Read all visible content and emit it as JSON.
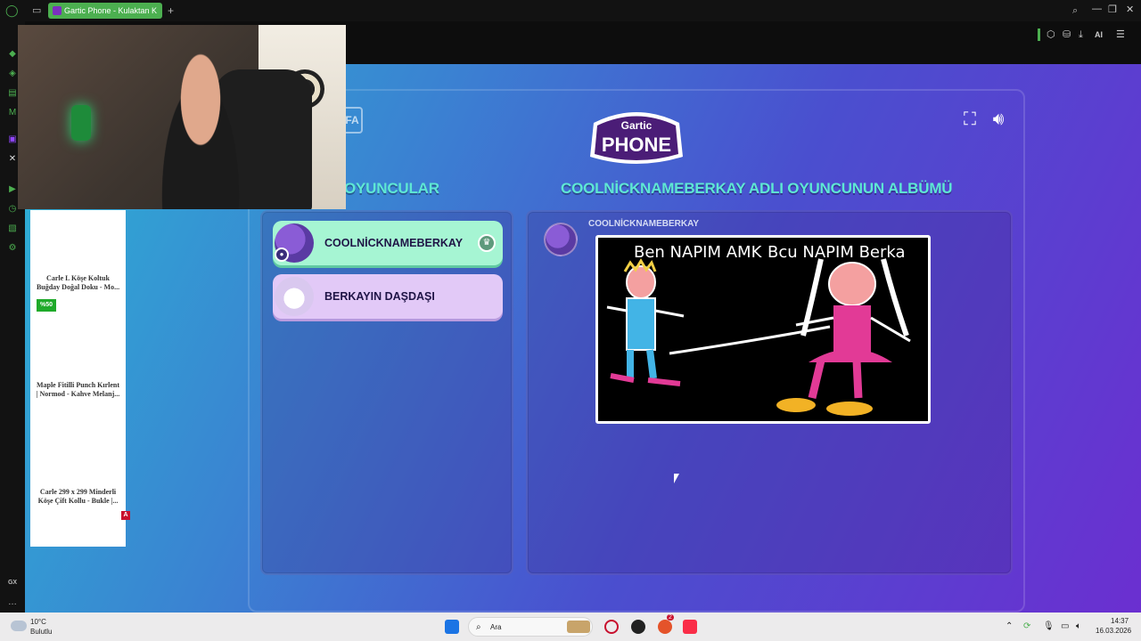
{
  "browser": {
    "tab_title": "Gartic Phone - Kulaktan K",
    "new_tab": "+",
    "ai_label": "AI",
    "sidebar_gx": "GX"
  },
  "ads": {
    "items": [
      {
        "title_line1": "Carle L Köşe Koltuk",
        "title_line2": "Buğday Doğal Doku - Mo..."
      },
      {
        "title_line1": "Maple Fitilli Punch Kırlent",
        "title_line2": "| Normod - Kahve Melanj..."
      },
      {
        "title_line1": "Carle 299 x 299 Minderli",
        "title_line2": "Köşe Çift Kollu - Bukle |..."
      }
    ],
    "discount_badge": "%50",
    "ad_mark": "A"
  },
  "game": {
    "logo_top": "Gartic",
    "logo_bottom": "PHONE",
    "back_button_partial": "FA",
    "players_title": "OYUNCULAR",
    "album_title": "COOLNİCKNAMEBERKAY ADLI OYUNCUNUN ALBÜMÜ",
    "players": [
      {
        "name": "COOLNİCKNAMEBERKAY",
        "host": true
      },
      {
        "name": "BERKAYIN DAŞDAŞI",
        "host": false
      }
    ],
    "album_author": "COOLNİCKNAMEBERKAY",
    "drawing_text_left": "Ben NAPIM AMK",
    "drawing_text_right": "Bcu NAPIM Berka"
  },
  "taskbar": {
    "temperature": "10°C",
    "weather": "Bulutlu",
    "search_placeholder": "Ara",
    "time": "14:37",
    "date": "16.03.2026",
    "notif_count": "2"
  },
  "colors": {
    "accent_green": "#4caf50",
    "title_teal": "#5ee7d4",
    "host_card": "#a6f5d3",
    "player_card": "#e2c9f7"
  }
}
